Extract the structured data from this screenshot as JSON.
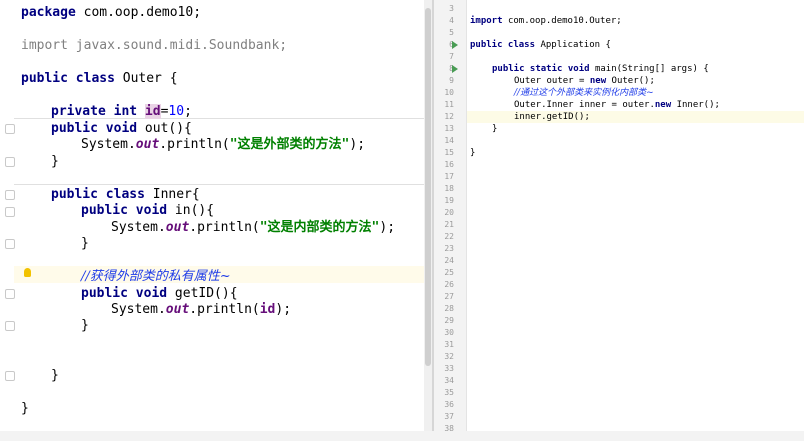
{
  "left_editor": {
    "lines": {
      "package_kw": "package",
      "package_name": "com.oop.demo10;",
      "import_kw": "import",
      "import_name": "javax.sound.midi.Soundbank;",
      "class_mod": "public class",
      "class_name": "Outer {",
      "field_mod": "private int",
      "field_name": "id",
      "field_value": "10",
      "field_end": ";",
      "out_sig_kw": "public void",
      "out_sig_rest": "out(){",
      "print1_pre": "System.",
      "print1_out": "out",
      "print1_mid": ".println(",
      "print1_str": "\"这是外部类的方法\"",
      "print1_end": ");",
      "close_brace": "}",
      "inner_kw": "public class",
      "inner_name": "Inner{",
      "in_sig_kw": "public void",
      "in_sig_rest": "in(){",
      "print2_pre": "System.",
      "print2_out": "out",
      "print2_mid": ".println(",
      "print2_str": "\"这是内部类的方法\"",
      "print2_end": ");",
      "comment": "//获得外部类的私有属性~",
      "getid_kw": "public void",
      "getid_rest": "getID(){",
      "print3_pre": "System.",
      "print3_out": "out",
      "print3_mid": ".println(",
      "print3_arg": "id",
      "print3_end": ");"
    }
  },
  "right_editor": {
    "line_numbers": [
      "3",
      "4",
      "5",
      "6",
      "7",
      "8",
      "9",
      "10",
      "11",
      "12",
      "13",
      "14",
      "15",
      "16",
      "17",
      "18",
      "19",
      "20",
      "21",
      "22",
      "23",
      "24",
      "25",
      "26",
      "27",
      "28",
      "29",
      "30",
      "31",
      "32",
      "33",
      "34",
      "35",
      "36",
      "37",
      "38"
    ],
    "lines": {
      "import_kw": "import",
      "import_name": "com.oop.demo10.Outer;",
      "class_kw": "public class",
      "class_name": "Application {",
      "main_kw": "public static void",
      "main_rest": "main(String[] args) {",
      "l9_pre": "Outer outer = ",
      "l9_kw": "new",
      "l9_post": " Outer();",
      "l10_comment": "//通过这个外部类来实例化内部类~",
      "l11_pre": "Outer.Inner inner = outer.",
      "l11_kw": "new",
      "l11_post": " Inner();",
      "l12": "inner.getID();",
      "l13": "}",
      "l15": "}"
    }
  }
}
